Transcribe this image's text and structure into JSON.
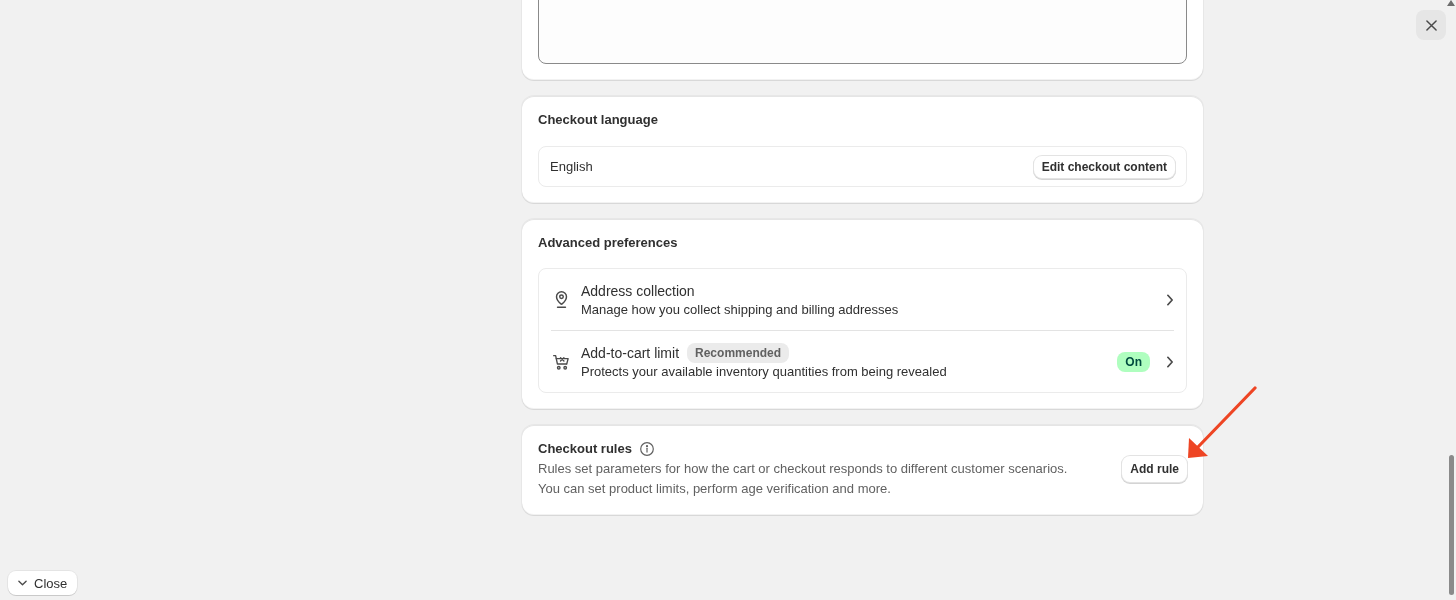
{
  "checkout_language": {
    "title": "Checkout language",
    "language": "English",
    "button": "Edit checkout content"
  },
  "advanced_preferences": {
    "title": "Advanced preferences",
    "items": [
      {
        "title": "Address collection",
        "description": "Manage how you collect shipping and billing addresses"
      },
      {
        "title": "Add-to-cart limit",
        "badge": {
          "label": "Recommended",
          "kind": "neutral"
        },
        "description": "Protects your available inventory quantities from being revealed",
        "status": {
          "label": "On",
          "kind": "success"
        }
      }
    ]
  },
  "checkout_rules": {
    "title": "Checkout rules",
    "description": [
      "Rules set parameters for how the cart or checkout responds to different customer scenarios.",
      "You can set product limits, perform age verification and more."
    ],
    "button": "Add rule"
  },
  "footer": {
    "close_button": "Close"
  }
}
